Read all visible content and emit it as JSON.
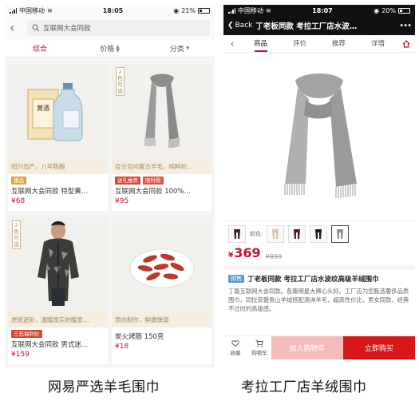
{
  "left": {
    "status": {
      "carrier": "中国移动",
      "time": "18:05",
      "battery": "21%"
    },
    "search": {
      "query": "互联网大会同款"
    },
    "tabs": {
      "t1": "综合",
      "t2": "价格",
      "t3": "分类"
    },
    "products": [
      {
        "tagline": "绍兴出产，八年陈酿",
        "badge1": "爆品",
        "title": "互联网大会同款 特型黄…",
        "price": "¥68",
        "label": "黄酒"
      },
      {
        "tagline": "百分百内蒙古羊毛，纯粹的…",
        "badge1": "送礼推荐",
        "badge2": "限时购",
        "title": "互联网大会同款 100%…",
        "price": "¥95",
        "vtag": "2色可选"
      },
      {
        "tagline": "虎斑迷彩，温暖厚实的暖意…",
        "badge1": "三石福利价",
        "title": "互联网大会同款 男式迷…",
        "price": "¥159",
        "vtag": "2色可选"
      },
      {
        "tagline": "原肉制作，鲜嫩弹润",
        "title": "炭火烤肠 150克",
        "price": "¥18"
      }
    ]
  },
  "right": {
    "status": {
      "carrier": "中国移动",
      "time": "18:07",
      "battery": "20%"
    },
    "nav": {
      "back": "Back",
      "title": "丁老板同款 考拉工厂店水波…",
      "more": "•••"
    },
    "tabs": {
      "t1": "商品",
      "t2": "评价",
      "t3": "推荐",
      "t4": "详情"
    },
    "color_label": "颜色:",
    "price": {
      "currency": "¥",
      "now": "369",
      "old": "¥899"
    },
    "desc": {
      "badge": "预售",
      "title": "丁老板同款 考拉工厂店水波纹高级羊绒围巾",
      "body": "丁磊互联网大会同款。各路明星大牌心头好。工厂店为您甄选奢侈品质围巾，同拉菲暨贵山羊绒搭配澳洲羊毛，超高性价比，男女同款，经典不过时的高级感。"
    },
    "bottom": {
      "fav": "收藏",
      "cart": "购物车",
      "add": "加入购物车",
      "buy": "立即购买"
    }
  },
  "captions": {
    "left": "网易严选羊毛围巾",
    "right": "考拉工厂店羊绒围巾"
  },
  "colors": {
    "accent": "#c8102e",
    "buy": "#d8171a",
    "addcart": "#f5bcbc",
    "tagline_bg": "#f5ede0"
  }
}
